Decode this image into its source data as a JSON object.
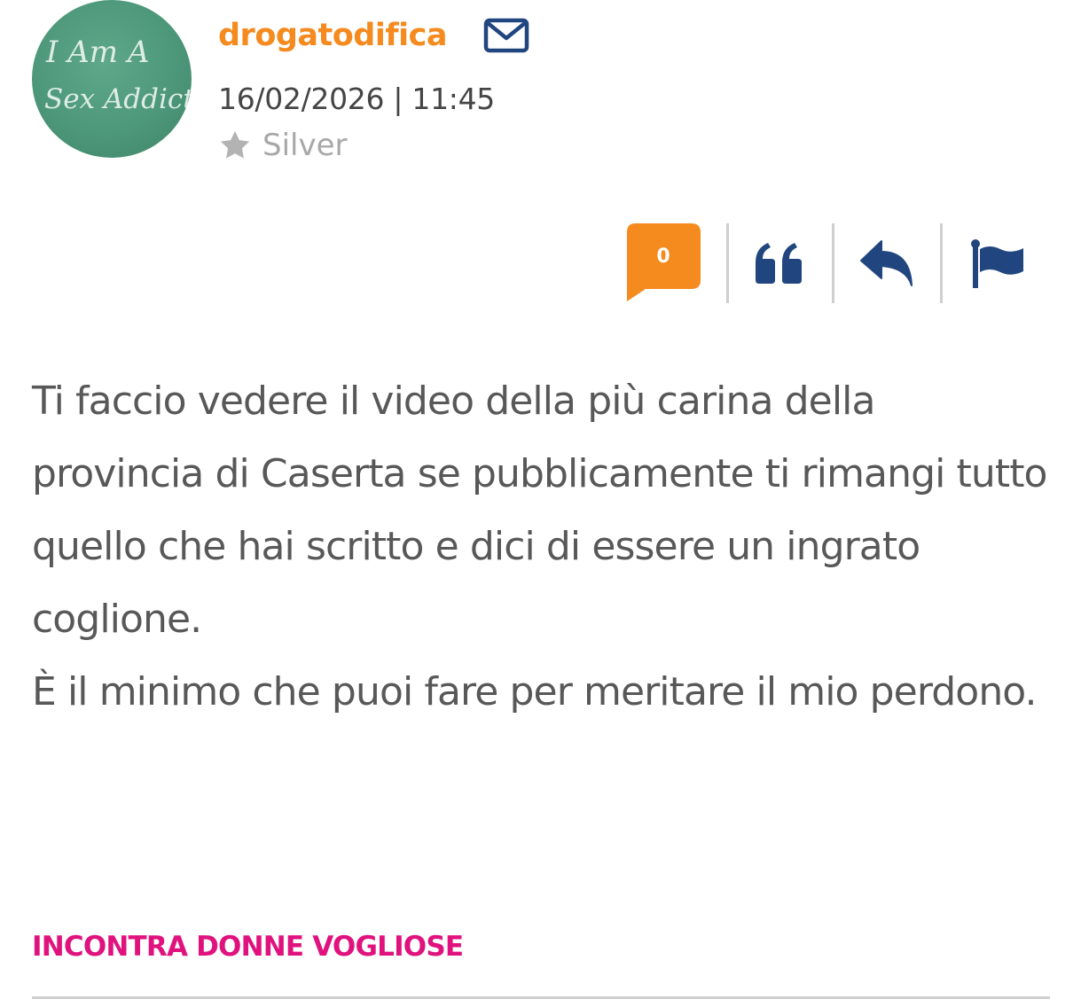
{
  "post": {
    "author": {
      "username": "drogatodifica",
      "avatar_text_line1": "I Am A",
      "avatar_text_line2": "Sex Addict",
      "rank": "Silver"
    },
    "datetime": "16/02/2026 | 11:45",
    "actions": {
      "like_count": "0"
    },
    "body": {
      "paragraph1": "Ti faccio vedere il video della più carina della provincia di Caserta se pubblicamente ti rimangi tutto quello che hai scritto e dici di essere un ingrato coglione.",
      "paragraph2": "È il minimo che puoi fare per meritare il mio perdono."
    },
    "promo_link": "INCONTRA DONNE VOGLIOSE"
  },
  "icons": {
    "mail": "envelope-icon",
    "rank": "star-icon",
    "like": "speech-bubble-icon",
    "quote": "quote-icon",
    "reply": "reply-arrow-icon",
    "report": "flag-icon"
  },
  "colors": {
    "username": "#f58a1f",
    "like_badge": "#f58a1f",
    "icon_blue": "#21467f",
    "promo_link": "#e0127e",
    "body_text": "#585858",
    "rank_text": "#a8a8a8"
  }
}
